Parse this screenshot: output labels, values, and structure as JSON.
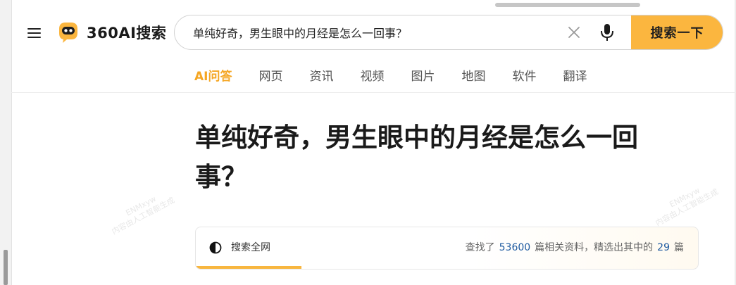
{
  "header": {
    "logo_text": "360AI搜索",
    "search": {
      "value": "单纯好奇，男生眼中的月经是怎么一回事？",
      "button_label": "搜索一下"
    }
  },
  "tabs": [
    {
      "label": "AI问答",
      "active": true
    },
    {
      "label": "网页",
      "active": false
    },
    {
      "label": "资讯",
      "active": false
    },
    {
      "label": "视频",
      "active": false
    },
    {
      "label": "图片",
      "active": false
    },
    {
      "label": "地图",
      "active": false
    },
    {
      "label": "软件",
      "active": false
    },
    {
      "label": "翻译",
      "active": false
    }
  ],
  "question": "单纯好奇，男生眼中的月经是怎么一回事？",
  "watermark": {
    "line1": "ENMxyw",
    "line2": "内容由人工智能生成"
  },
  "result": {
    "status_label": "搜索全网",
    "stats_prefix": "查找了",
    "found_count": "53600",
    "stats_middle": "篇相关资料，精选出其中的",
    "selected_count": "29",
    "stats_suffix": "篇",
    "progress": 0.21
  },
  "colors": {
    "accent": "#f5a623",
    "search_button": "#fbb63f",
    "link_number": "#1e5aa0"
  },
  "icons": {
    "menu": "menu-icon",
    "logo": "robot-logo-icon",
    "clear": "close-icon",
    "mic": "microphone-icon",
    "status": "half-circle-loading-icon"
  }
}
